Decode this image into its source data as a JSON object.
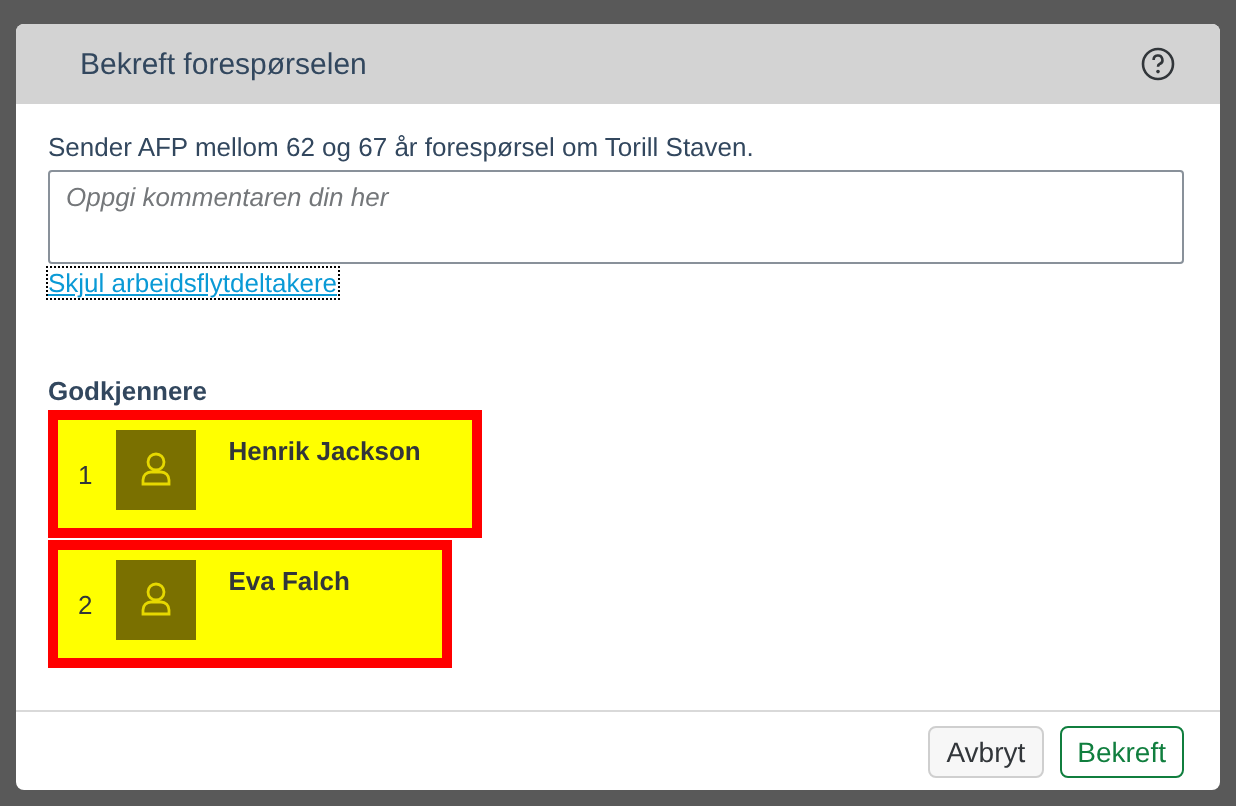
{
  "dialog": {
    "title": "Bekreft forespørselen",
    "message": "Sender AFP mellom 62 og 67 år forespørsel om Torill Staven.",
    "comment": {
      "placeholder": "Oppgi kommentaren din her"
    },
    "toggle_link": "Skjul arbeidsflytdeltakere",
    "approvers_heading": "Godkjennere",
    "approvers": [
      {
        "number": "1",
        "name": "Henrik Jackson"
      },
      {
        "number": "2",
        "name": "Eva Falch"
      }
    ],
    "buttons": [
      {
        "label": "Avbryt",
        "kind": "secondary"
      },
      {
        "label": "Bekreft",
        "kind": "primary"
      }
    ]
  }
}
